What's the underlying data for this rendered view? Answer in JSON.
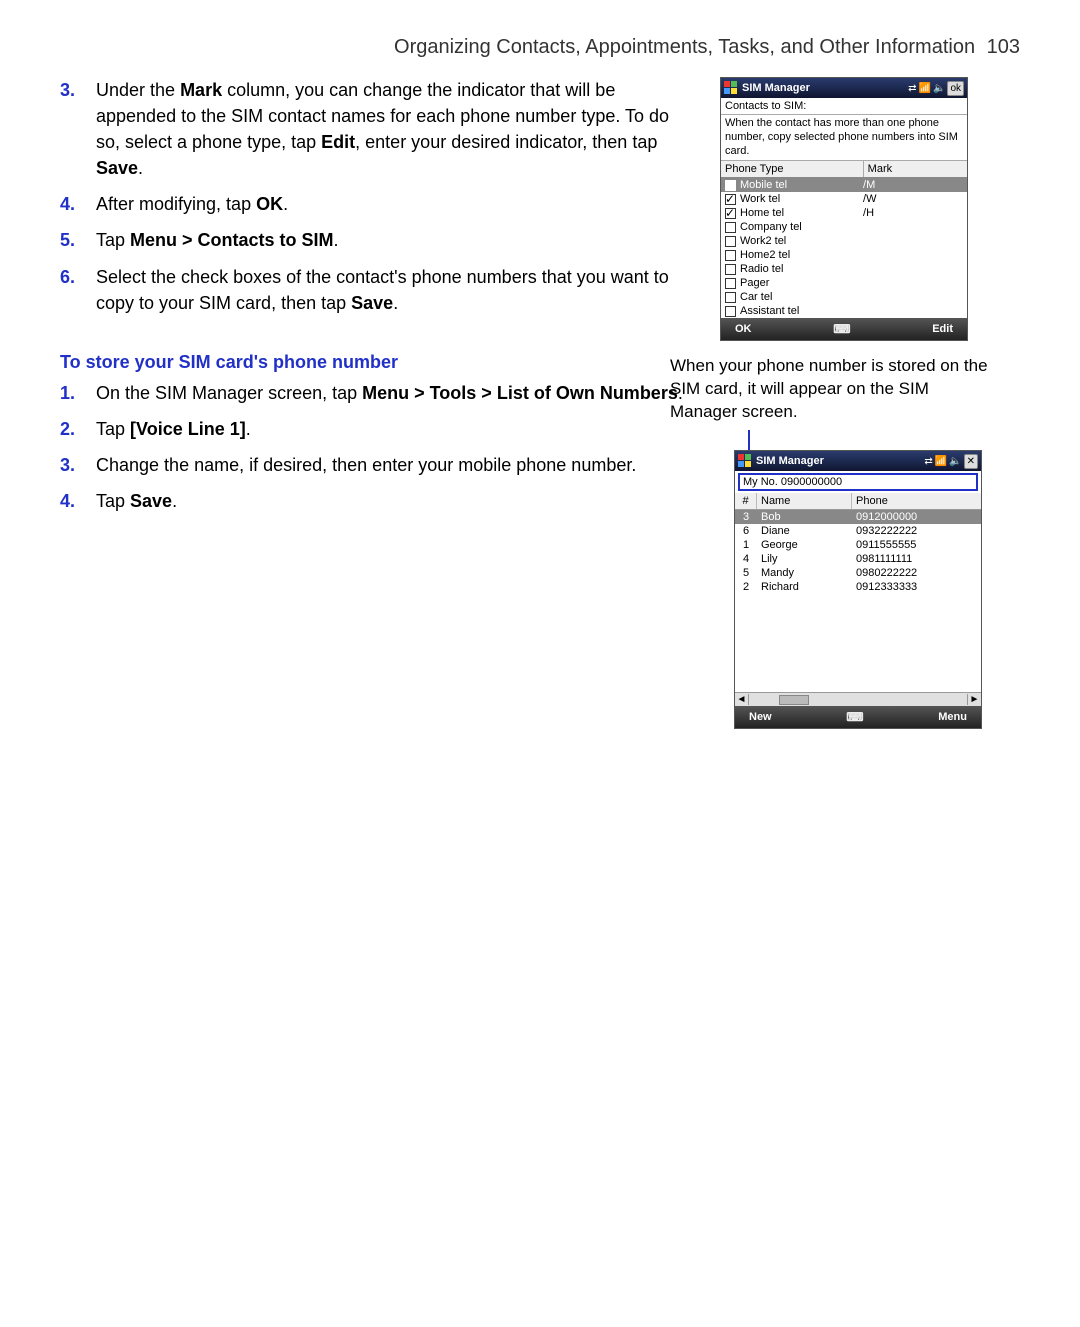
{
  "header": {
    "chapter": "Organizing Contacts, Appointments, Tasks, and Other Information",
    "page": "103"
  },
  "stepsA": [
    {
      "n": "3.",
      "html": "Under the <b>Mark</b> column, you can change the indicator that will be appended to the SIM contact names for each phone number type. To do so, select a phone type, tap <b>Edit</b>, enter your desired indicator, then tap <b>Save</b>."
    },
    {
      "n": "4.",
      "html": "After modifying, tap <b>OK</b>."
    },
    {
      "n": "5.",
      "html": "Tap <b>Menu > Contacts to SIM</b>."
    },
    {
      "n": "6.",
      "html": "Select the check boxes of the contact's phone numbers that you want to copy to your SIM card, then tap <b>Save</b>."
    }
  ],
  "sectionTitle": "To store your SIM card's phone number",
  "stepsB": [
    {
      "n": "1.",
      "html": "On the SIM Manager screen, tap <b>Menu > Tools > List of Own Numbers</b>."
    },
    {
      "n": "2.",
      "html": "Tap <b>[Voice Line 1]</b>."
    },
    {
      "n": "3.",
      "html": "Change the name, if desired, then enter your mobile phone number."
    },
    {
      "n": "4.",
      "html": "Tap <b>Save</b>."
    }
  ],
  "caption": "When your phone number is stored on the SIM card, it will appear on the SIM Manager screen.",
  "ss1": {
    "title": "SIM Manager",
    "okText": "ok",
    "sub": "Contacts to SIM:",
    "note": "When the contact has more than one phone number, copy selected phone numbers into SIM card.",
    "col1": "Phone Type",
    "col2": "Mark",
    "rows": [
      {
        "checked": true,
        "sel": true,
        "label": "Mobile tel",
        "mark": "/M"
      },
      {
        "checked": true,
        "sel": false,
        "label": "Work tel",
        "mark": "/W"
      },
      {
        "checked": true,
        "sel": false,
        "label": "Home tel",
        "mark": "/H"
      },
      {
        "checked": false,
        "sel": false,
        "label": "Company tel",
        "mark": ""
      },
      {
        "checked": false,
        "sel": false,
        "label": "Work2 tel",
        "mark": ""
      },
      {
        "checked": false,
        "sel": false,
        "label": "Home2 tel",
        "mark": ""
      },
      {
        "checked": false,
        "sel": false,
        "label": "Radio tel",
        "mark": ""
      },
      {
        "checked": false,
        "sel": false,
        "label": "Pager",
        "mark": ""
      },
      {
        "checked": false,
        "sel": false,
        "label": "Car tel",
        "mark": ""
      },
      {
        "checked": false,
        "sel": false,
        "label": "Assistant tel",
        "mark": ""
      }
    ],
    "softLeft": "OK",
    "softRight": "Edit"
  },
  "ss2": {
    "title": "SIM Manager",
    "myno": "My No. 0900000000",
    "thIdx": "#",
    "thName": "Name",
    "thPhone": "Phone",
    "rows": [
      {
        "sel": true,
        "idx": "3",
        "name": "Bob",
        "phone": "0912000000"
      },
      {
        "sel": false,
        "idx": "6",
        "name": "Diane",
        "phone": "0932222222"
      },
      {
        "sel": false,
        "idx": "1",
        "name": "George",
        "phone": "0911555555"
      },
      {
        "sel": false,
        "idx": "4",
        "name": "Lily",
        "phone": "0981111111"
      },
      {
        "sel": false,
        "idx": "5",
        "name": "Mandy",
        "phone": "0980222222"
      },
      {
        "sel": false,
        "idx": "2",
        "name": "Richard",
        "phone": "0912333333"
      }
    ],
    "softLeft": "New",
    "softRight": "Menu"
  }
}
